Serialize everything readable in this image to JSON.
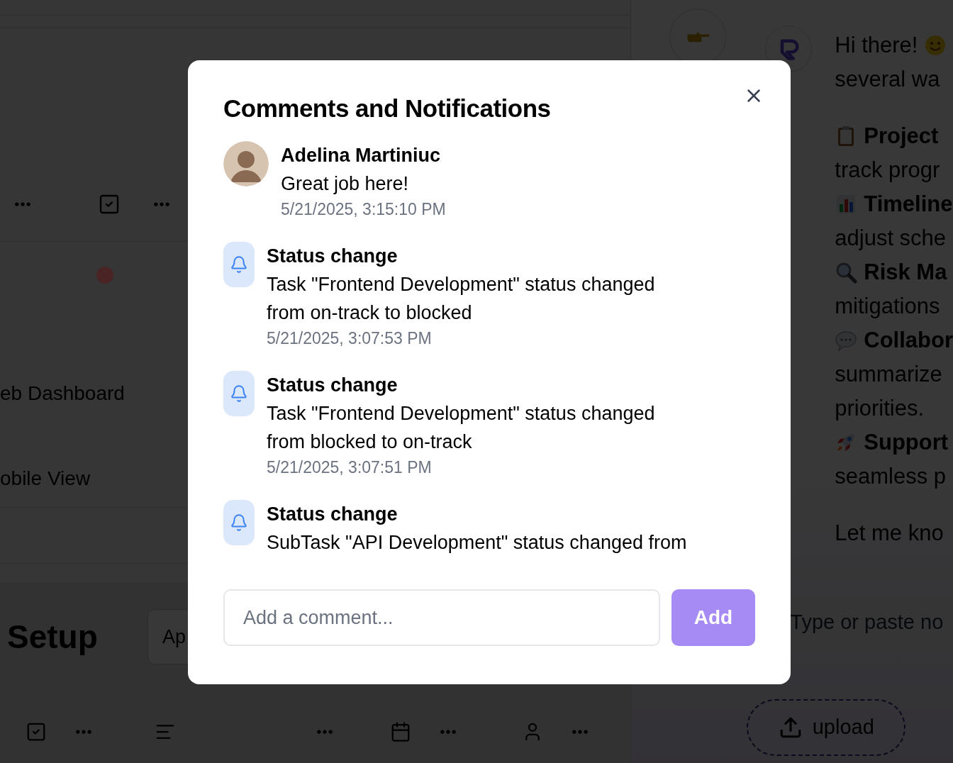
{
  "background": {
    "labels": [
      "eb Dashboard",
      "obile View"
    ],
    "status_dot": {
      "color": "#4a2424"
    },
    "section_title": "Setup",
    "section_button": "Ap",
    "chat": {
      "greeting": [
        "Hi there!",
        "several wa"
      ],
      "items": [
        {
          "kind": "clipboard",
          "title": "Project",
          "lines": [
            "track progr"
          ]
        },
        {
          "kind": "chart",
          "title": "Timeline",
          "lines": [
            "adjust sche"
          ]
        },
        {
          "kind": "magnifier",
          "title": "Risk Ma",
          "lines": [
            "mitigations"
          ]
        },
        {
          "kind": "speech",
          "title": "Collabor",
          "lines": [
            "summarize",
            "priorities."
          ]
        },
        {
          "kind": "rocket",
          "title": "Support",
          "lines": [
            "seamless p"
          ]
        }
      ],
      "closing": "Let me kno",
      "placeholder": "Type or paste no",
      "upload": "upload"
    }
  },
  "dialog": {
    "title": "Comments and Notifications",
    "entries": [
      {
        "kind": "comment",
        "author": "Adelina Martiniuc",
        "lines": [
          "Great job here!"
        ],
        "time": "5/21/2025, 3:15:10 PM"
      },
      {
        "kind": "notification",
        "author": "Status change",
        "lines": [
          "Task \"Frontend Development\" status changed",
          "from on-track to blocked"
        ],
        "time": "5/21/2025, 3:07:53 PM"
      },
      {
        "kind": "notification",
        "author": "Status change",
        "lines": [
          "Task \"Frontend Development\" status changed",
          "from blocked to on-track"
        ],
        "time": "5/21/2025, 3:07:51 PM"
      },
      {
        "kind": "notification",
        "author": "Status change",
        "lines": [
          "SubTask \"API Development\" status changed from"
        ]
      }
    ],
    "comment_field": {
      "placeholder": "Add a comment..."
    },
    "add_button": "Add"
  }
}
